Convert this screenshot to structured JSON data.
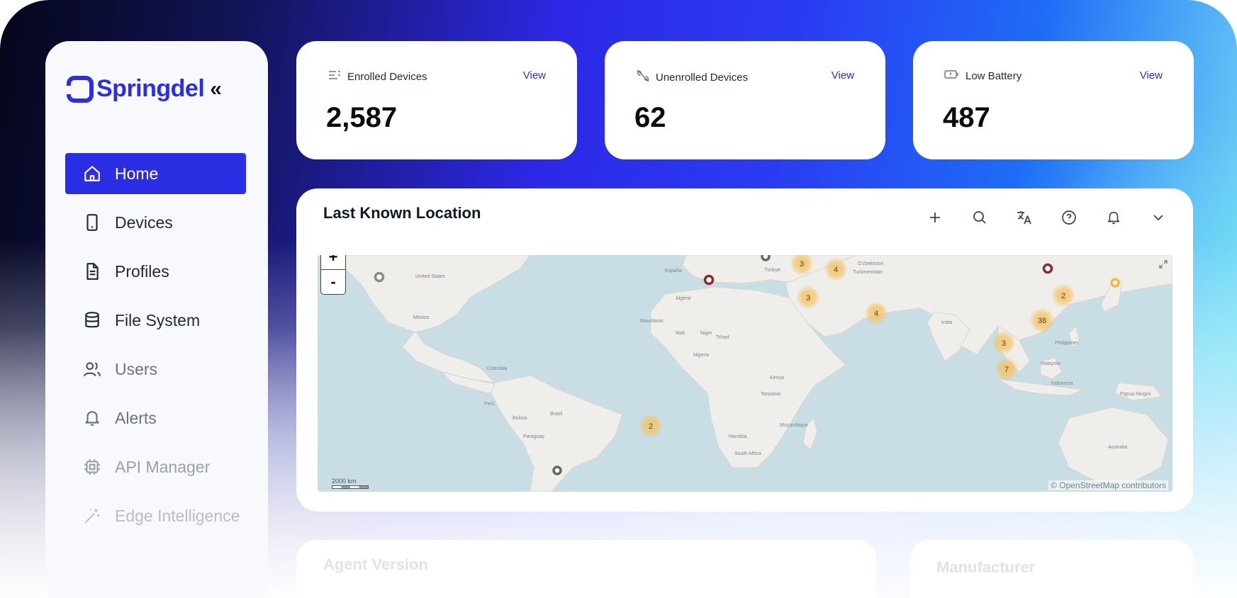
{
  "app": {
    "name": "Springdel"
  },
  "sidebar": {
    "items": [
      {
        "label": "Home",
        "icon": "home-icon",
        "active": true
      },
      {
        "label": "Devices",
        "icon": "smartphone-icon"
      },
      {
        "label": "Profiles",
        "icon": "document-icon"
      },
      {
        "label": "File System",
        "icon": "database-icon"
      },
      {
        "label": "Users",
        "icon": "users-icon"
      },
      {
        "label": "Alerts",
        "icon": "bell-icon"
      },
      {
        "label": "API Manager",
        "icon": "chip-icon"
      },
      {
        "label": "Edge Intelligence",
        "icon": "magic-wand-icon"
      }
    ]
  },
  "stats": [
    {
      "title": "Enrolled Devices",
      "value": "2,587",
      "link": "View",
      "icon": "list-icon"
    },
    {
      "title": "Unenrolled Devices",
      "value": "62",
      "link": "View",
      "icon": "unlink-icon"
    },
    {
      "title": "Low Battery",
      "value": "487",
      "link": "View",
      "icon": "battery-low-icon"
    }
  ],
  "map_card": {
    "title": "Last Known Location",
    "zoom_in": "+",
    "zoom_out": "-",
    "attribution": "© OpenStreetMap contributors",
    "scale": "2000 km",
    "tools": [
      "plus-icon",
      "search-icon",
      "translate-icon",
      "help-icon",
      "bell-icon",
      "chevron-down-icon"
    ],
    "clusters": [
      {
        "count": "3"
      },
      {
        "count": "4"
      },
      {
        "count": "3"
      },
      {
        "count": "4"
      },
      {
        "count": "2"
      },
      {
        "count": "38"
      },
      {
        "count": "3"
      },
      {
        "count": "7"
      },
      {
        "count": "2"
      }
    ],
    "place_labels": [
      "United States",
      "México",
      "Colombia",
      "Perú",
      "Bolivia",
      "Brasil",
      "Paraguay",
      "España",
      "Algérie",
      "Mauritanie",
      "Mali",
      "Niger",
      "Nigeria",
      "Tchad",
      "Kenya",
      "Tanzania",
      "Türkiye",
      "Indonesia",
      "Philippines",
      "Malaysia",
      "India",
      "Australia",
      "Papua Niugini",
      "South Africa",
      "Moçambique",
      "Namibia",
      "O'zbekiston",
      "Turkmenistan"
    ]
  },
  "bottom_cards": [
    {
      "title": "Agent Version"
    },
    {
      "title": "Manufacturer"
    }
  ],
  "colors": {
    "brand": "#2b2ee3",
    "cluster": "#f4c46a",
    "marker": "#8b2c2c"
  }
}
